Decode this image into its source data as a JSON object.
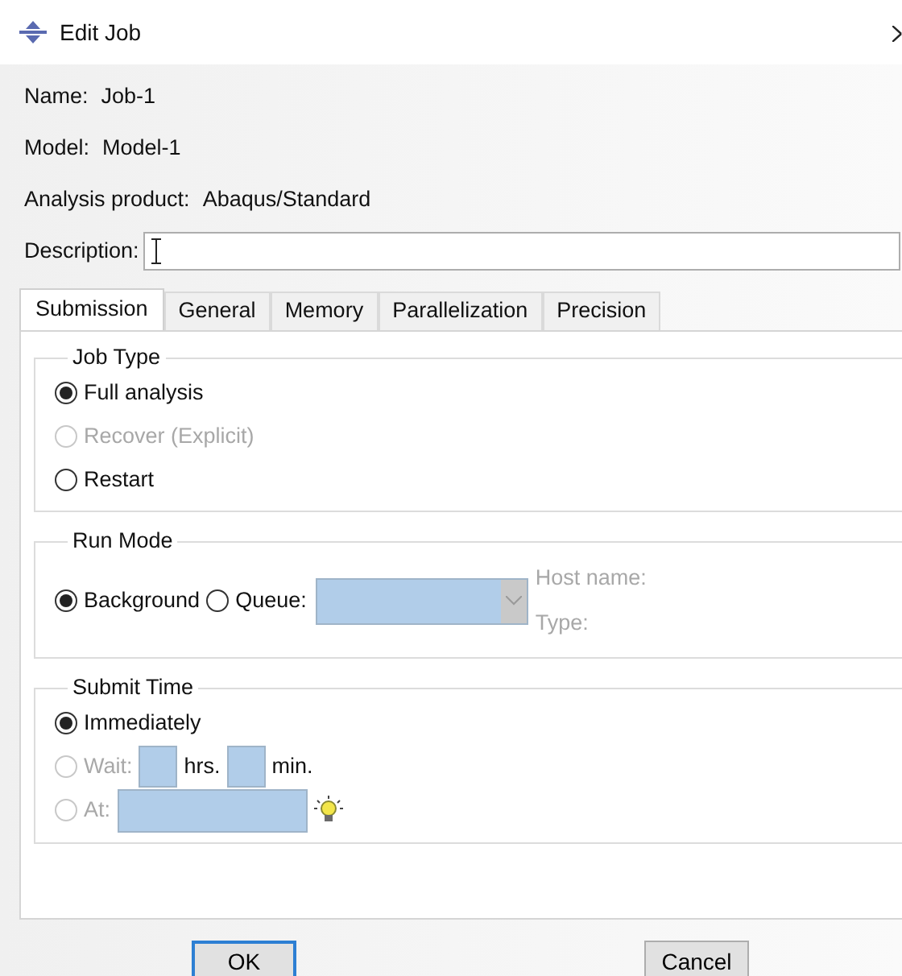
{
  "window": {
    "title": "Edit Job"
  },
  "info": [
    {
      "label": "Name:",
      "value": "Job-1"
    },
    {
      "label": "Model:",
      "value": "Model-1"
    },
    {
      "label": "Analysis product:",
      "value": "Abaqus/Standard"
    }
  ],
  "description": {
    "label": "Description:"
  },
  "tabs": [
    {
      "label": "Submission",
      "selected": true
    },
    {
      "label": "General",
      "selected": false
    },
    {
      "label": "Memory",
      "selected": false
    },
    {
      "label": "Parallelization",
      "selected": false
    },
    {
      "label": "Precision",
      "selected": false
    }
  ],
  "job_type": {
    "title": "Job Type",
    "options": [
      {
        "label": "Full analysis",
        "selected": true,
        "disabled": false
      },
      {
        "label": "Recover (Explicit)",
        "selected": false,
        "disabled": true
      },
      {
        "label": "Restart",
        "selected": false,
        "disabled": false
      }
    ]
  },
  "run_mode": {
    "title": "Run Mode",
    "options": [
      {
        "label": "Background",
        "selected": true,
        "disabled": false
      },
      {
        "label": "Queue:",
        "selected": false,
        "disabled": false
      }
    ],
    "host_name_label": "Host name:",
    "type_label": "Type:"
  },
  "submit_time": {
    "title": "Submit Time",
    "options": [
      {
        "kind": "plain",
        "label": "Immediately",
        "selected": true,
        "disabled": false
      },
      {
        "kind": "wait",
        "label": "Wait:",
        "selected": false,
        "disabled": true,
        "hours_unit": "hrs.",
        "minutes_unit": "min."
      },
      {
        "kind": "at",
        "label": "At:",
        "selected": false,
        "disabled": true
      }
    ]
  },
  "buttons": [
    {
      "label": "OK",
      "default": true
    },
    {
      "label": "Cancel",
      "default": false
    }
  ]
}
